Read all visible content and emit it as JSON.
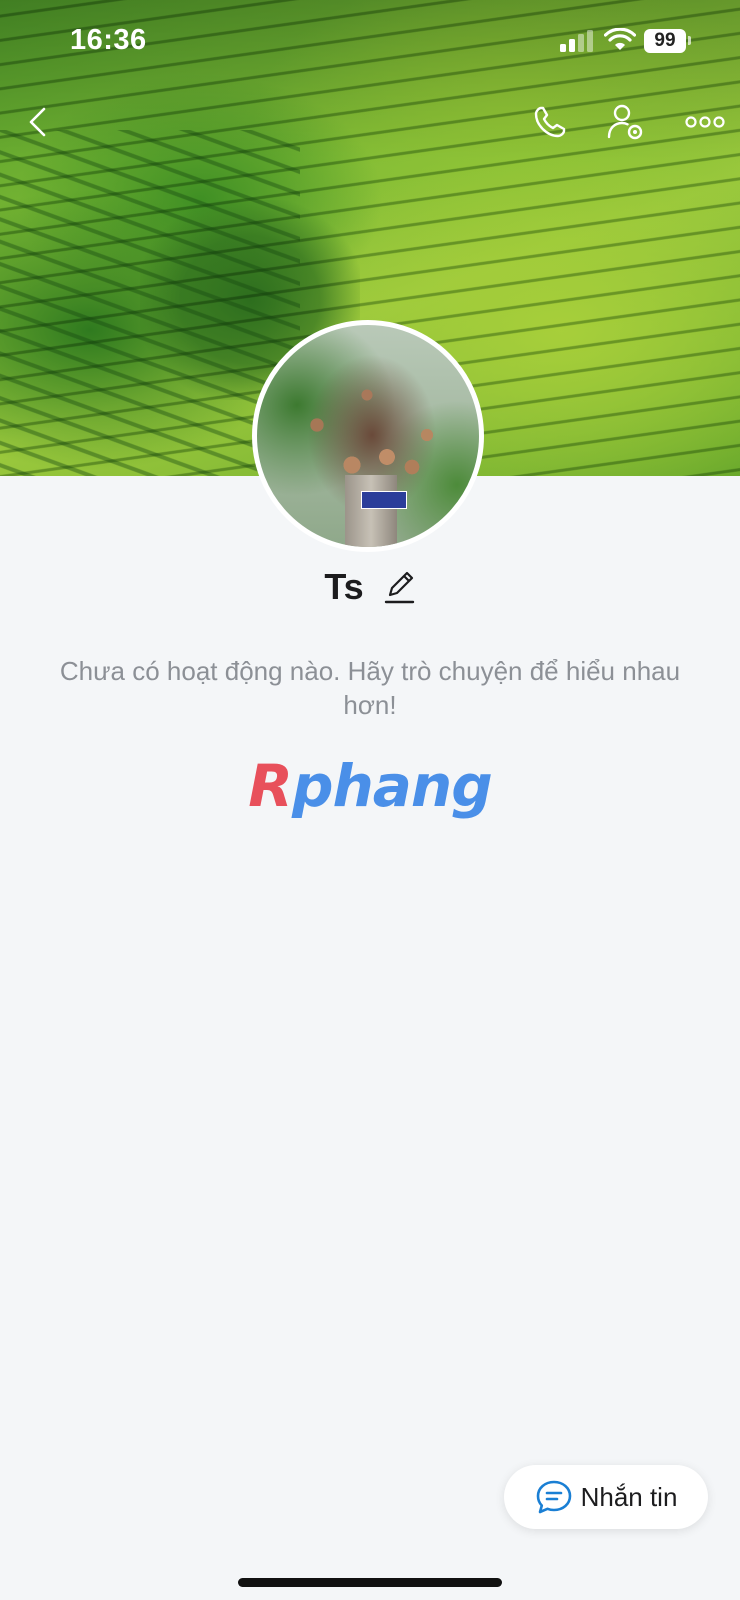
{
  "status_bar": {
    "time": "16:36",
    "battery": "99"
  },
  "profile": {
    "name": "Ts",
    "empty_message": "Chưa có hoạt động nào. Hãy trò chuyện để hiểu nhau hơn!"
  },
  "watermark": {
    "part_a": "R",
    "part_b": "phang"
  },
  "actions": {
    "message_label": "Nhắn tin"
  },
  "icons": [
    "chevron-left-icon",
    "phone-icon",
    "user-settings-icon",
    "more-icon",
    "pencil-icon",
    "chat-bubble-icon"
  ],
  "colors": {
    "background": "#f4f6f8",
    "text_primary": "#1c1c1e",
    "text_muted": "#8c9096",
    "accent": "#1a7fd4"
  }
}
